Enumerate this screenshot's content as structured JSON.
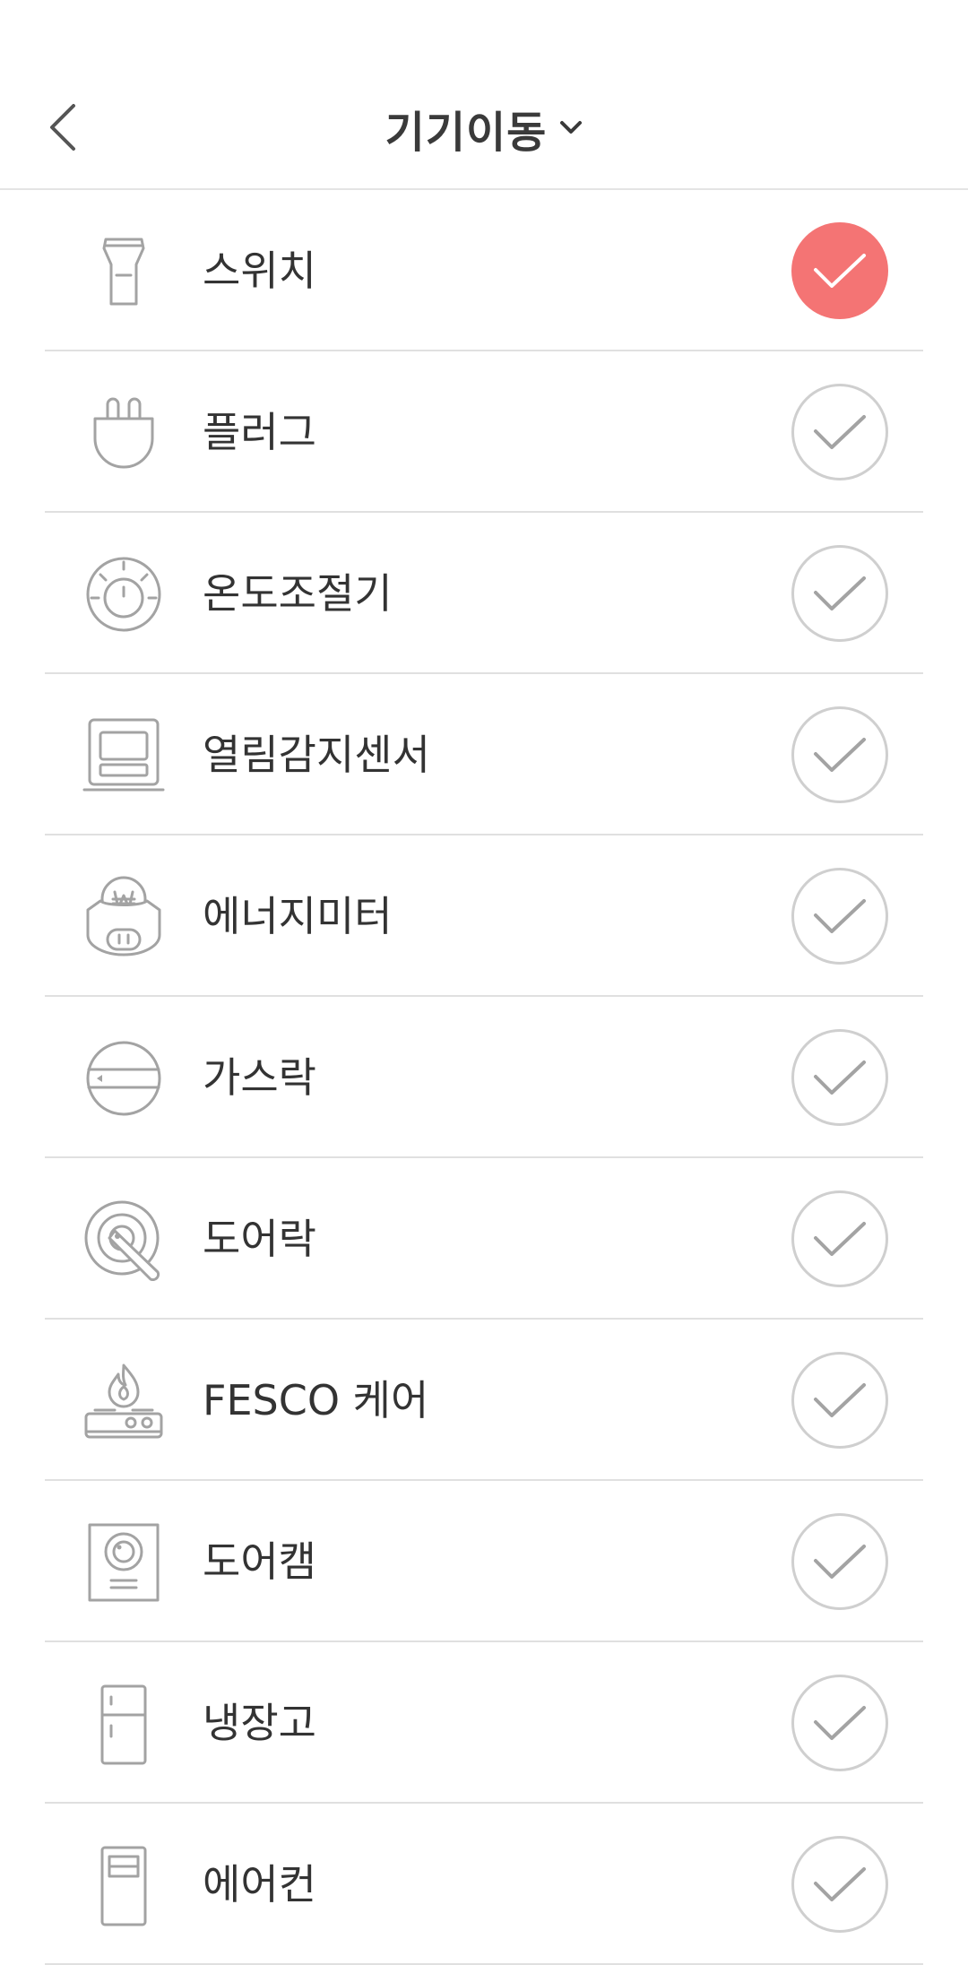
{
  "header": {
    "title": "기기이동",
    "back_icon": "chevron-left-icon",
    "dropdown_icon": "chevron-down-icon"
  },
  "colors": {
    "accent": "#f47474",
    "check_off": "#cfcfcf",
    "icon": "#a3a3a3"
  },
  "devices": [
    {
      "label": "스위치",
      "icon": "switch-icon",
      "checked": true
    },
    {
      "label": "플러그",
      "icon": "plug-icon",
      "checked": false
    },
    {
      "label": "온도조절기",
      "icon": "thermostat-icon",
      "checked": false
    },
    {
      "label": "열림감지센서",
      "icon": "door-sensor-icon",
      "checked": false
    },
    {
      "label": "에너지미터",
      "icon": "energy-meter-icon",
      "checked": false
    },
    {
      "label": "가스락",
      "icon": "gas-lock-icon",
      "checked": false
    },
    {
      "label": "도어락",
      "icon": "door-lock-icon",
      "checked": false
    },
    {
      "label": "FESCO 케어",
      "icon": "gas-stove-icon",
      "checked": false
    },
    {
      "label": "도어캠",
      "icon": "door-cam-icon",
      "checked": false
    },
    {
      "label": "냉장고",
      "icon": "refrigerator-icon",
      "checked": false
    },
    {
      "label": "에어컨",
      "icon": "air-conditioner-icon",
      "checked": false
    }
  ]
}
